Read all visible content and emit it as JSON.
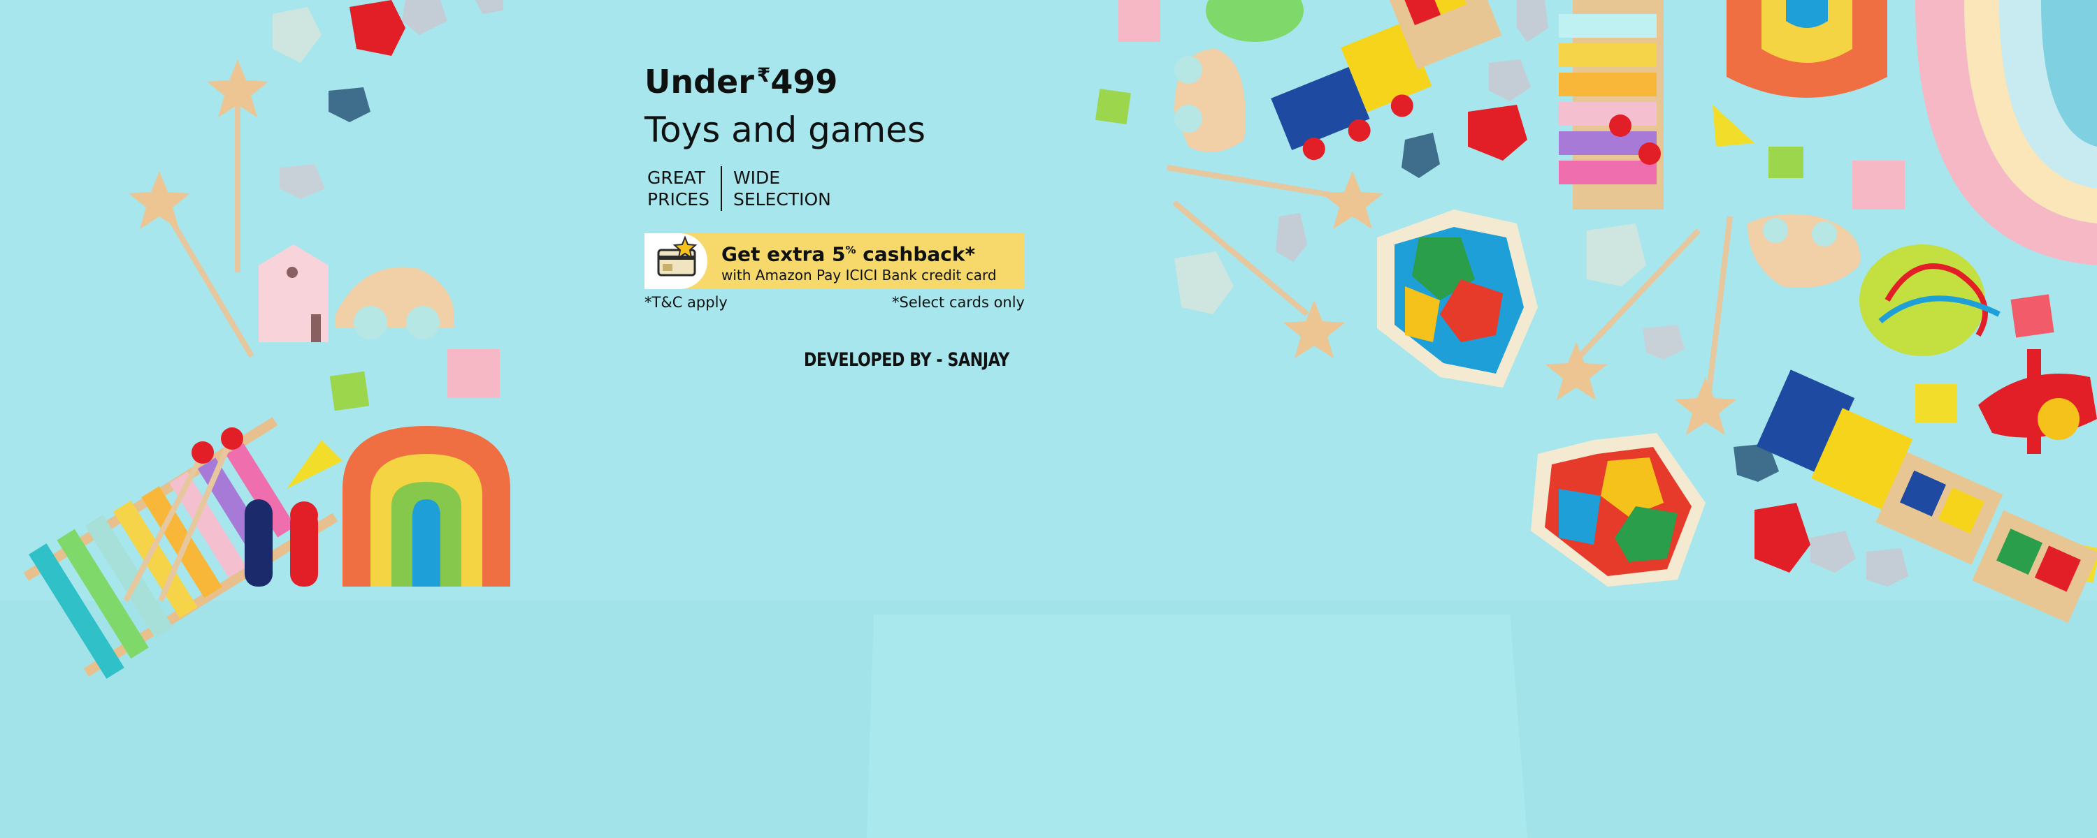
{
  "banner": {
    "headline_prefix": "Under",
    "currency_symbol": "₹",
    "price": "499",
    "subheadline": "Toys and games",
    "features": [
      "GREAT\nPRICES",
      "WIDE\nSELECTION"
    ],
    "cashback": {
      "title_prefix": "Get extra 5",
      "percent_sign": "%",
      "title_suffix": " cashback*",
      "subtitle": "with Amazon Pay ICICI Bank credit card",
      "icon": "credit-card-star-icon"
    },
    "notes": {
      "left": "*T&C apply",
      "right": "*Select cards only"
    },
    "credit": "DEVELOPED BY - SANJAY"
  },
  "colors": {
    "background": "#a6e6ec",
    "cashback_yellow": "#f7d96b",
    "text": "#0f1111"
  }
}
